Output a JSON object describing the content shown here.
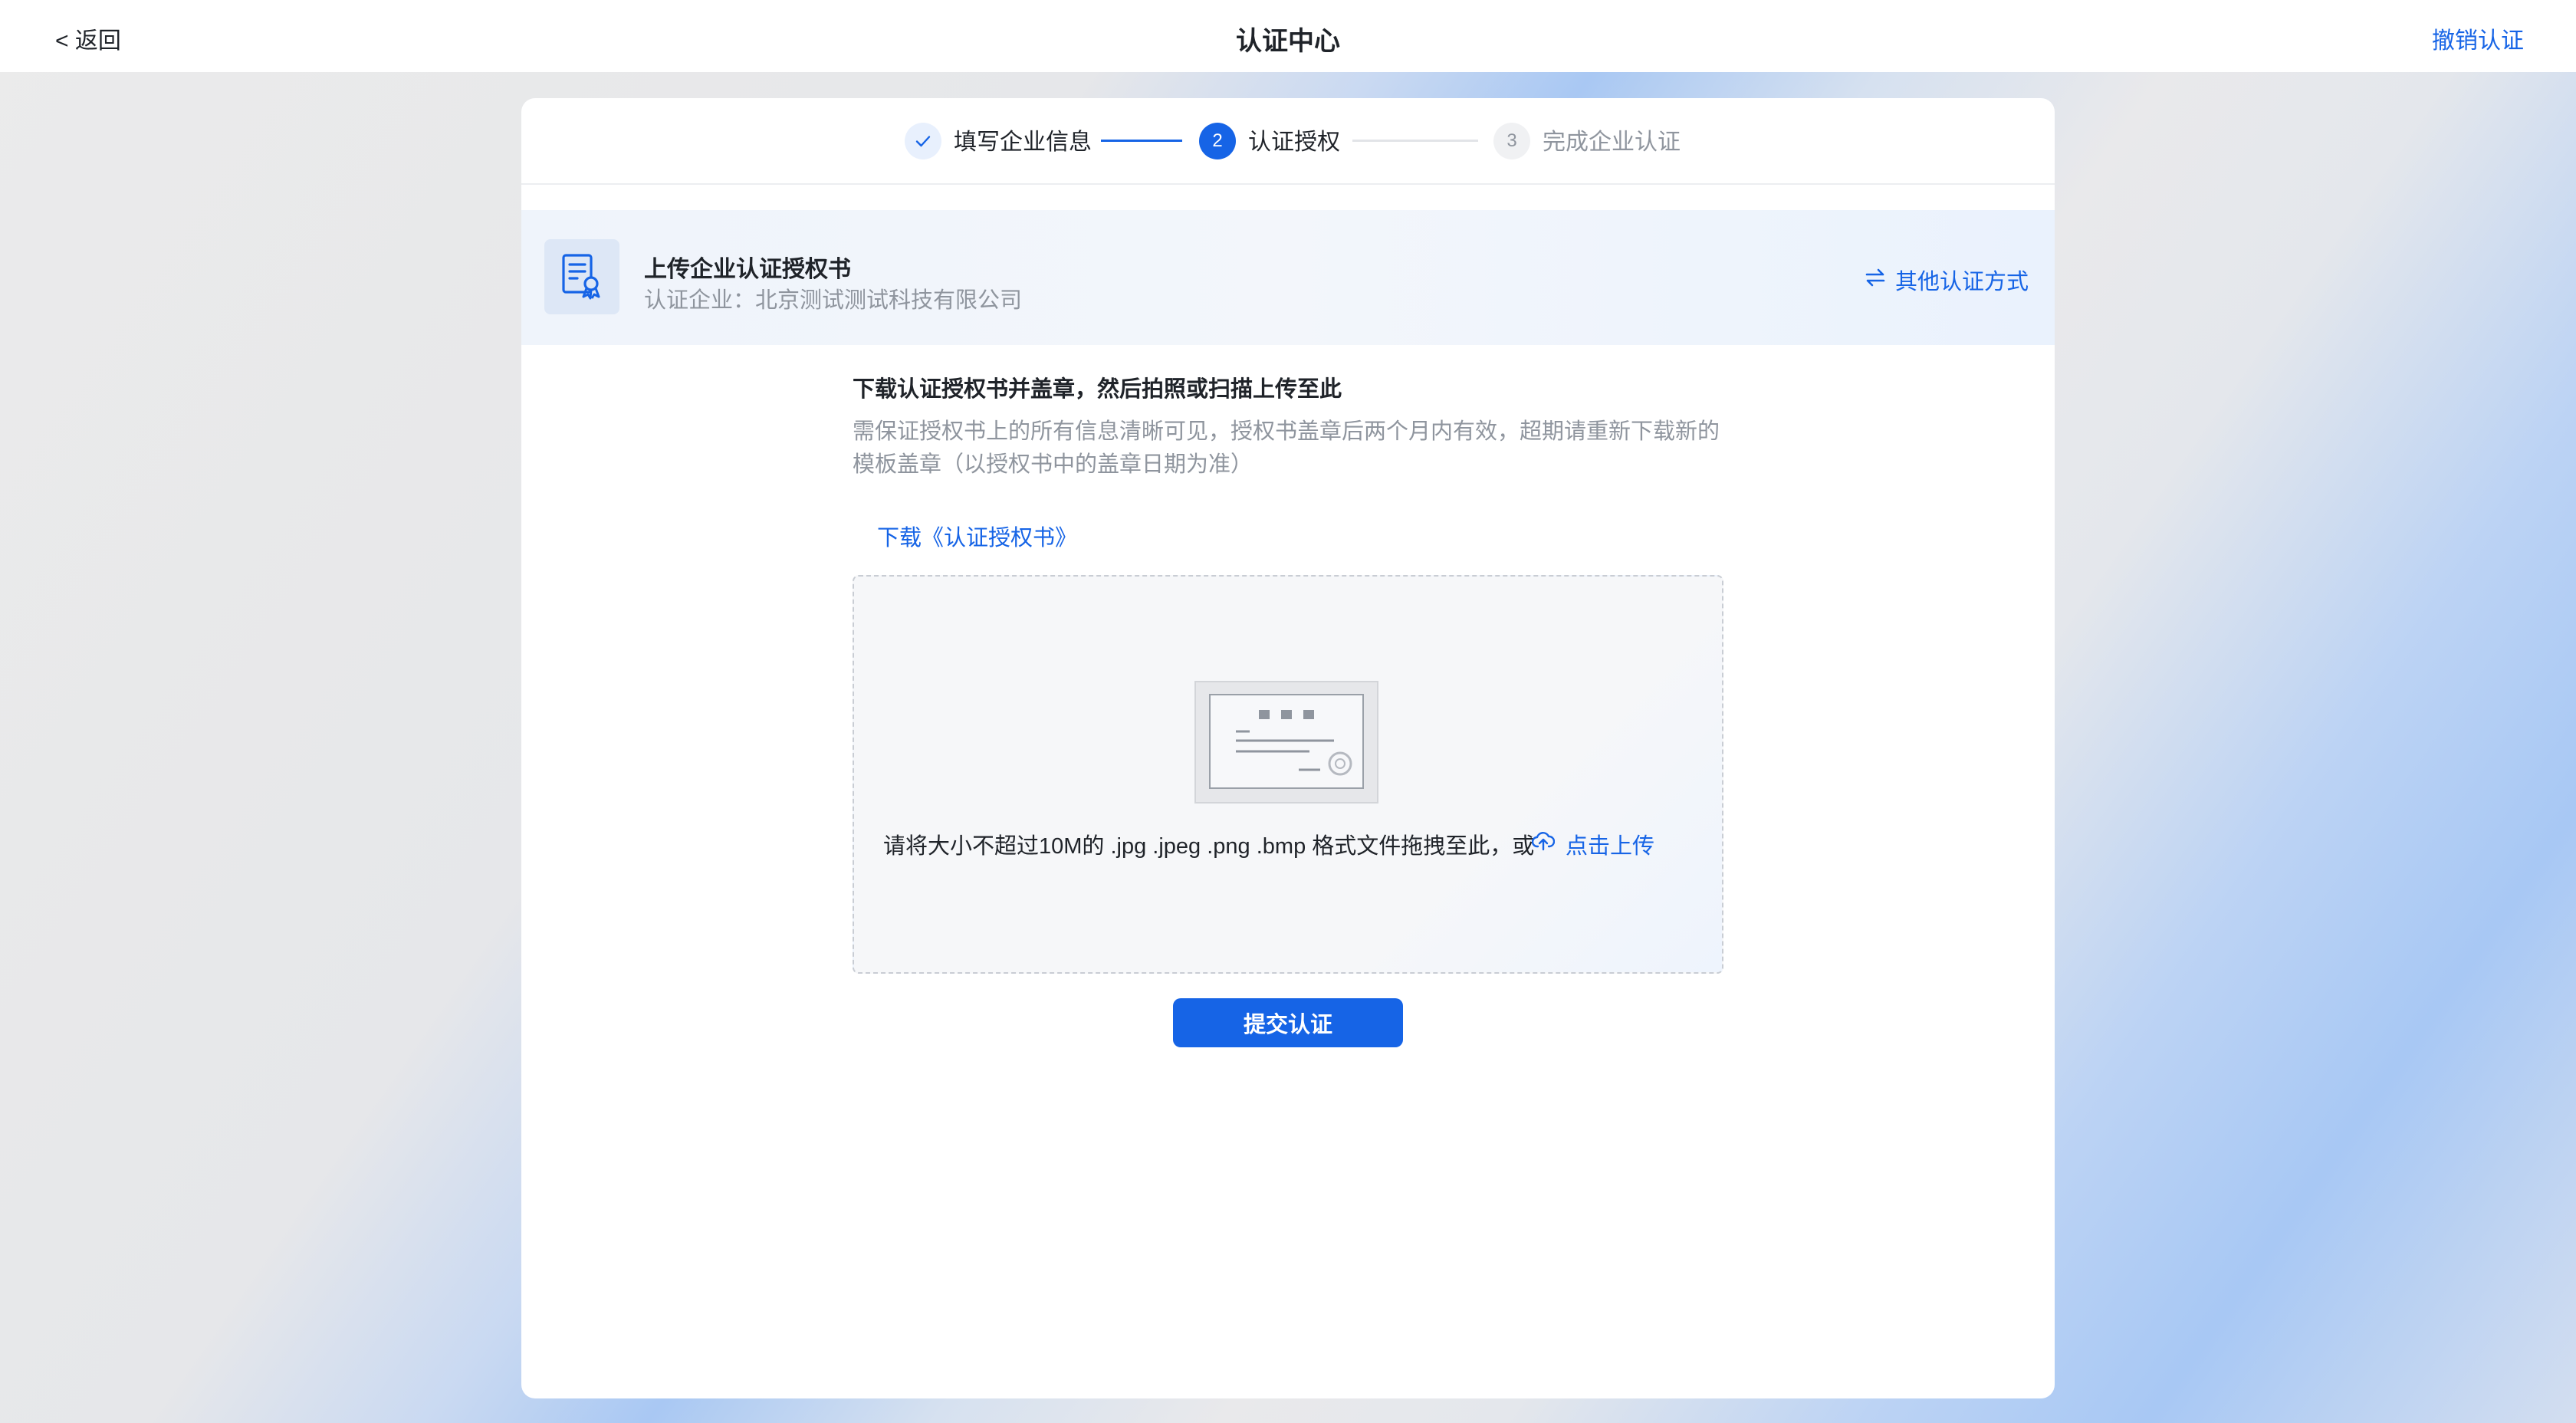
{
  "header": {
    "back_label": "< 返回",
    "title": "认证中心",
    "revoke_label": "撤销认证"
  },
  "steps": [
    {
      "index": "1",
      "label": "填写企业信息",
      "status": "done"
    },
    {
      "index": "2",
      "label": "认证授权",
      "status": "active"
    },
    {
      "index": "3",
      "label": "完成企业认证",
      "status": "pending"
    }
  ],
  "info": {
    "icon": "certificate-doc-icon",
    "title": "上传企业认证授权书",
    "subtitle_prefix": "认证企业：",
    "company": "北京测试测试科技有限公司",
    "other_method_label": "其他认证方式",
    "other_method_icon": "swap-arrows-icon"
  },
  "instructions": {
    "title": "下载认证授权书并盖章，然后拍照或扫描上传至此",
    "desc": "需保证授权书上的所有信息清晰可见，授权书盖章后两个月内有效，超期请重新下载新的模板盖章（以授权书中的盖章日期为准）",
    "download_link": "下载《认证授权书》"
  },
  "dropzone": {
    "text": "请将大小不超过10M的 .jpg .jpeg .png .bmp 格式文件拖拽至此，或",
    "upload_label": "点击上传",
    "upload_icon": "cloud-upload-icon"
  },
  "submit_label": "提交认证",
  "colors": {
    "accent": "#1664e6",
    "muted_text": "#8f959e",
    "primary_text": "#1f2329"
  }
}
